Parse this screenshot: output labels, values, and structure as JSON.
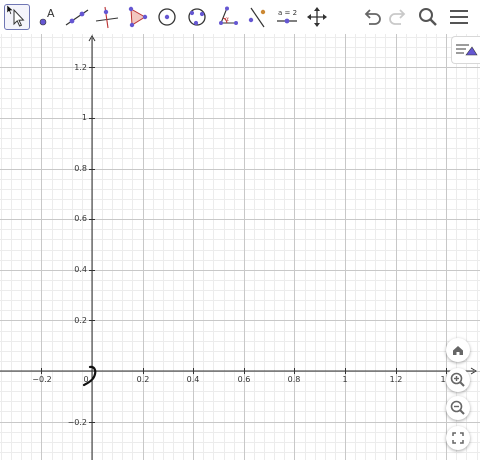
{
  "app": "GeoGebra Graphing",
  "toolbar": {
    "tools": [
      {
        "id": "move",
        "icon": "arrow-pointer-icon",
        "selected": true
      },
      {
        "id": "point",
        "icon": "point-icon",
        "label": "A"
      },
      {
        "id": "line",
        "icon": "line-through-points-icon"
      },
      {
        "id": "perpendicular",
        "icon": "perpendicular-line-icon"
      },
      {
        "id": "polygon",
        "icon": "polygon-icon"
      },
      {
        "id": "circle",
        "icon": "circle-center-point-icon"
      },
      {
        "id": "conic",
        "icon": "conic-through-points-icon"
      },
      {
        "id": "angle",
        "icon": "angle-icon"
      },
      {
        "id": "reflect",
        "icon": "reflect-about-line-icon"
      },
      {
        "id": "slider",
        "icon": "slider-icon",
        "label": "a = 2"
      },
      {
        "id": "move-view",
        "icon": "move-graphics-view-icon"
      }
    ],
    "right_tools": [
      "undo-icon",
      "redo-icon",
      "search-icon",
      "menu-icon"
    ]
  },
  "graphics": {
    "x_axis": {
      "ticks": [
        "−0.2",
        "0",
        "0.2",
        "0.4",
        "0.6",
        "0.8",
        "1",
        "1.2",
        "1"
      ]
    },
    "y_axis": {
      "ticks": [
        "1.2",
        "1",
        "0.8",
        "0.6",
        "0.4",
        "0.2",
        "−0.2"
      ]
    },
    "grid": true,
    "axis_color": "#333333",
    "grid_major_color": "#c8c8c8",
    "grid_minor_color": "#ececec",
    "accent_color": "#6557d2"
  },
  "view_controls": [
    "home-icon",
    "zoom-in-icon",
    "zoom-out-icon",
    "fullscreen-icon"
  ]
}
